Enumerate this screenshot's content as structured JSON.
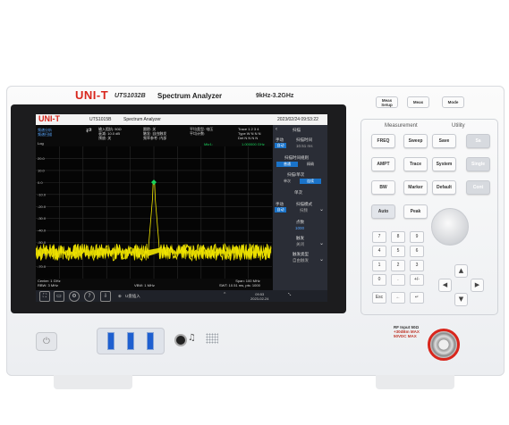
{
  "device": {
    "brand": "UNI-T",
    "model": "UTS1032B",
    "product_name": "Spectrum Analyzer",
    "freq_range": "9kHz-3.2GHz",
    "colors": {
      "brand_red": "#d8261c",
      "trace_yellow": "#f2e600",
      "selected_blue": "#1a73c9"
    }
  },
  "front_top_buttons": [
    {
      "label": "Meas\nSetup"
    },
    {
      "label": "Meas"
    },
    {
      "label": "Mode"
    }
  ],
  "screen": {
    "titlebar": {
      "logo": "UNI-T",
      "model": "UTS1015B",
      "name": "Spectrum Analyzer",
      "datetime": "2023/02/24 09:53:22"
    },
    "status": {
      "left": [
        "频谱分析",
        "频谱扫描"
      ],
      "input": [
        "输入阻抗: 50Ω",
        "衰减: 10.0 dB",
        "预放: 关"
      ],
      "mid": [
        "跟踪: 关",
        "触发: 自由触发",
        "频率参考: 内部"
      ],
      "avg": [
        "平均类型: 电压",
        "平均计数:"
      ],
      "trace": [
        "Trace 1 2 3 4",
        "Type W N N N",
        "Det N N N N"
      ]
    },
    "scale": {
      "line1": "Log",
      "line2": "Scale: 10.0 dB",
      "ref": "Ref Lvl: 30.00 dBm"
    },
    "marker": {
      "label": "Mkr1:",
      "freq": "1.000000 GHz",
      "amp_label": "Ampl:",
      "amp": "0.17 dBm"
    },
    "y_ticks": [
      "20.0",
      "10.0",
      "0.0",
      "-10.0",
      "-20.0",
      "-30.0",
      "-40.0",
      "-50.0",
      "-60.0",
      "-70.0"
    ],
    "footer": {
      "center": "Center: 1 GHz",
      "rbw": "RBW: 3 MHz",
      "vbw": "VBW: 1 MHz",
      "span": "Span: 100 MHz",
      "swt": "SWT: 10.51 ms, pts: 1000"
    },
    "side": {
      "title": "扫描",
      "sweep_time_label": "扫描时间",
      "sweep_time_mode": "手动",
      "sweep_time_mode2": "自动",
      "sweep_time_value": "10.51 ms",
      "rule_label": "扫描时间规则",
      "rule_opt1": "普通",
      "rule_opt2": "精确",
      "cont_label": "扫描/单次",
      "cont_opt1": "单次",
      "cont_opt2": "连续",
      "single": "单次",
      "mode_label": "扫描模式",
      "mode_value": "扫频",
      "mode_auto": "自动",
      "mode_manual": "手动",
      "points_label": "点数",
      "points_value": "1000",
      "gate_label": "触发",
      "gate_value": "关闭",
      "gate_type_label": "触发类型",
      "gate_type_value": "自由触发"
    },
    "taskbar": {
      "hint": "U盘插入",
      "time": "09:53",
      "date": "2023-02-24"
    }
  },
  "panel": {
    "measurement_label": "Measurement",
    "utility_label": "Utility",
    "buttons": [
      "FREQ",
      "Sweep",
      "Save",
      "AMPT",
      "Trace",
      "System",
      "BW",
      "Marker",
      "Default",
      "Auto",
      "Peak"
    ],
    "utility_buttons": [
      "Sa",
      "Single",
      "Cont"
    ],
    "keypad": [
      "7",
      "8",
      "9",
      "4",
      "5",
      "6",
      "1",
      "2",
      "3",
      "0",
      ".",
      "+/-",
      "Esc",
      "←",
      "↵"
    ]
  },
  "rf": {
    "line1": "RF Input 50Ω",
    "line2": "+30dBm MAX",
    "line3": "50VDC MAX"
  },
  "chart_data": {
    "type": "line",
    "title": "",
    "xlabel": "",
    "ylabel": "",
    "x_range_ghz": [
      0.95,
      1.05
    ],
    "ylim": [
      -80,
      30
    ],
    "series": [
      {
        "name": "",
        "peak_x": 1.0,
        "peak_y": 0.17,
        "noise_floor": -58
      }
    ]
  }
}
